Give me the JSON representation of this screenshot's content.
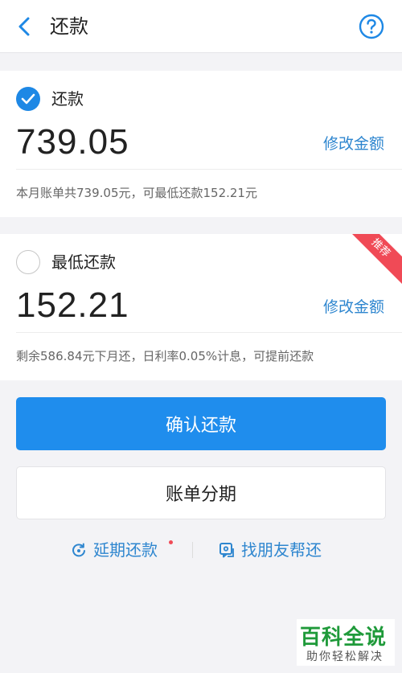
{
  "header": {
    "title": "还款",
    "back_icon": "chevron-left-icon",
    "help_icon": "question-circle-icon"
  },
  "options": [
    {
      "label": "还款",
      "checked": true,
      "amount": "739.05",
      "modify_label": "修改金额",
      "note": "本月账单共739.05元，可最低还款152.21元"
    },
    {
      "label": "最低还款",
      "checked": false,
      "amount": "152.21",
      "modify_label": "修改金额",
      "note": "剩余586.84元下月还，日利率0.05%计息，可提前还款",
      "badge": "推荐"
    }
  ],
  "actions": {
    "confirm_label": "确认还款",
    "installment_label": "账单分期"
  },
  "links": {
    "defer_label": "延期还款",
    "friend_label": "找朋友帮还"
  },
  "watermark": {
    "main": "百科全说",
    "sub": "助你轻松解决"
  },
  "colors": {
    "accent": "#1f8ded",
    "link": "#2e86cf",
    "badge": "#f04a56",
    "background": "#f3f3f6"
  }
}
